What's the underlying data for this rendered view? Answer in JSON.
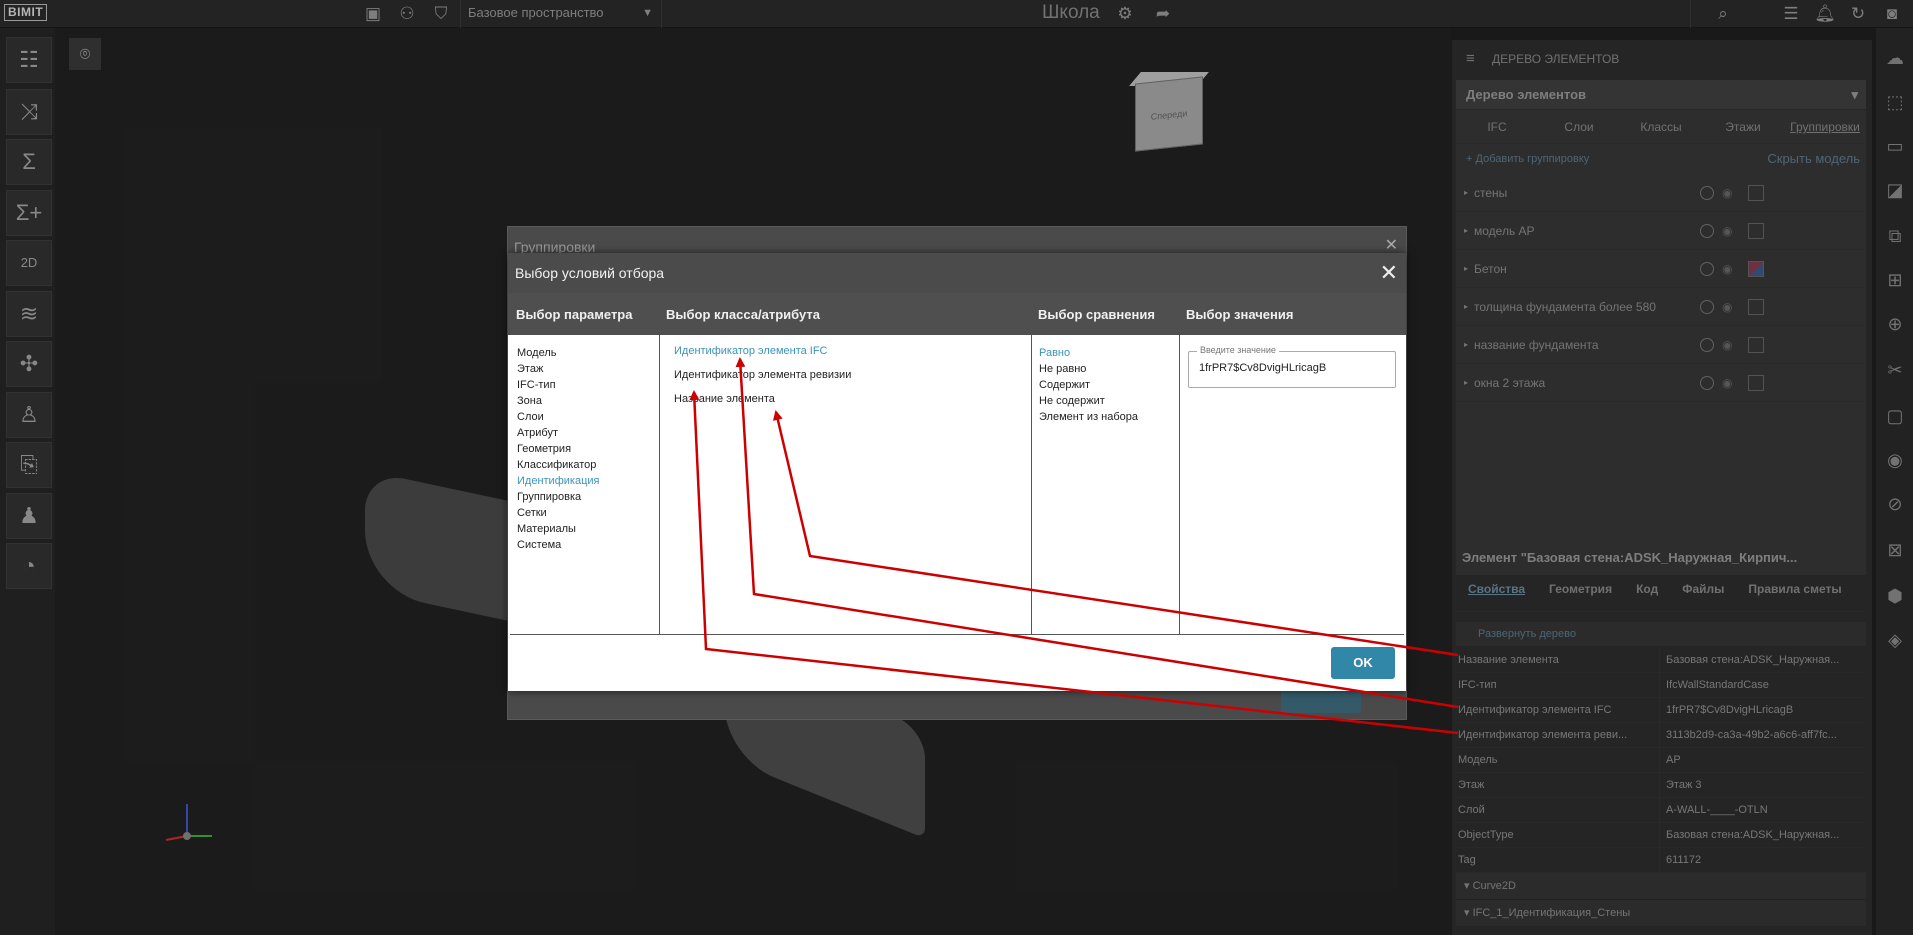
{
  "topbar": {
    "logo": "BIMIT",
    "space": "Базовое пространство",
    "project_title": "Школа"
  },
  "right_panel": {
    "header": "ДЕРЕВО ЭЛЕМЕНТОВ",
    "tree_select": "Дерево элементов",
    "tabs": [
      "IFC",
      "Слои",
      "Классы",
      "Этажи",
      "Группировки"
    ],
    "add_group": "Добавить группировку",
    "hide_model": "Скрыть модель",
    "groups": [
      "стены",
      "модель АР",
      "Бетон",
      "толщина фундамента более 580",
      "название фундамента",
      "окна 2 этажа"
    ],
    "element_title": "Элемент \"Базовая стена:ADSK_Наружная_Кирпич...",
    "element_tabs": [
      "Свойства",
      "Геометрия",
      "Код",
      "Файлы",
      "Правила сметы"
    ],
    "expand_tree": "Развернуть дерево",
    "props": [
      {
        "k": "Название элемента",
        "v": "Базовая стена:ADSK_Наружная..."
      },
      {
        "k": "IFC-тип",
        "v": "IfcWallStandardCase"
      },
      {
        "k": "Идентификатор элемента IFC",
        "v": "1frPR7$Cv8DvigHLricagB"
      },
      {
        "k": "Идентификатор элемента реви...",
        "v": "3113b2d9-ca3a-49b2-a6c6-aff7fc..."
      },
      {
        "k": "Модель",
        "v": "АР"
      },
      {
        "k": "Этаж",
        "v": "Этаж 3"
      },
      {
        "k": "Слой",
        "v": "A-WALL-____-OTLN"
      },
      {
        "k": "ObjectType",
        "v": "Базовая стена:ADSK_Наружная..."
      },
      {
        "k": "Tag",
        "v": "611172"
      }
    ],
    "prop_groups": [
      "Curve2D",
      "IFC_1_Идентификация_Стены"
    ]
  },
  "bg_dialog": {
    "title": "Группировки"
  },
  "dialog": {
    "title": "Выбор условий отбора",
    "col_headers": [
      "Выбор параметра",
      "Выбор класса/атрибута",
      "Выбор сравнения",
      "Выбор значения"
    ],
    "params": [
      "Модель",
      "Этаж",
      "IFC-тип",
      "Зона",
      "Слои",
      "Атрибут",
      "Геометрия",
      "Классификатор",
      "Идентификация",
      "Группировка",
      "Сетки",
      "Материалы",
      "Система"
    ],
    "attributes": [
      "Идентификатор элемента IFC",
      "Идентификатор элемента ревизии",
      "Название элемента"
    ],
    "comparisons": [
      "Равно",
      "Не равно",
      "Содержит",
      "Не содержит",
      "Элемент из набора"
    ],
    "value_label": "Введите значение",
    "value": "1frPR7$Cv8DvigHLricagB",
    "ok": "OK"
  },
  "viewcube": "Спереди"
}
